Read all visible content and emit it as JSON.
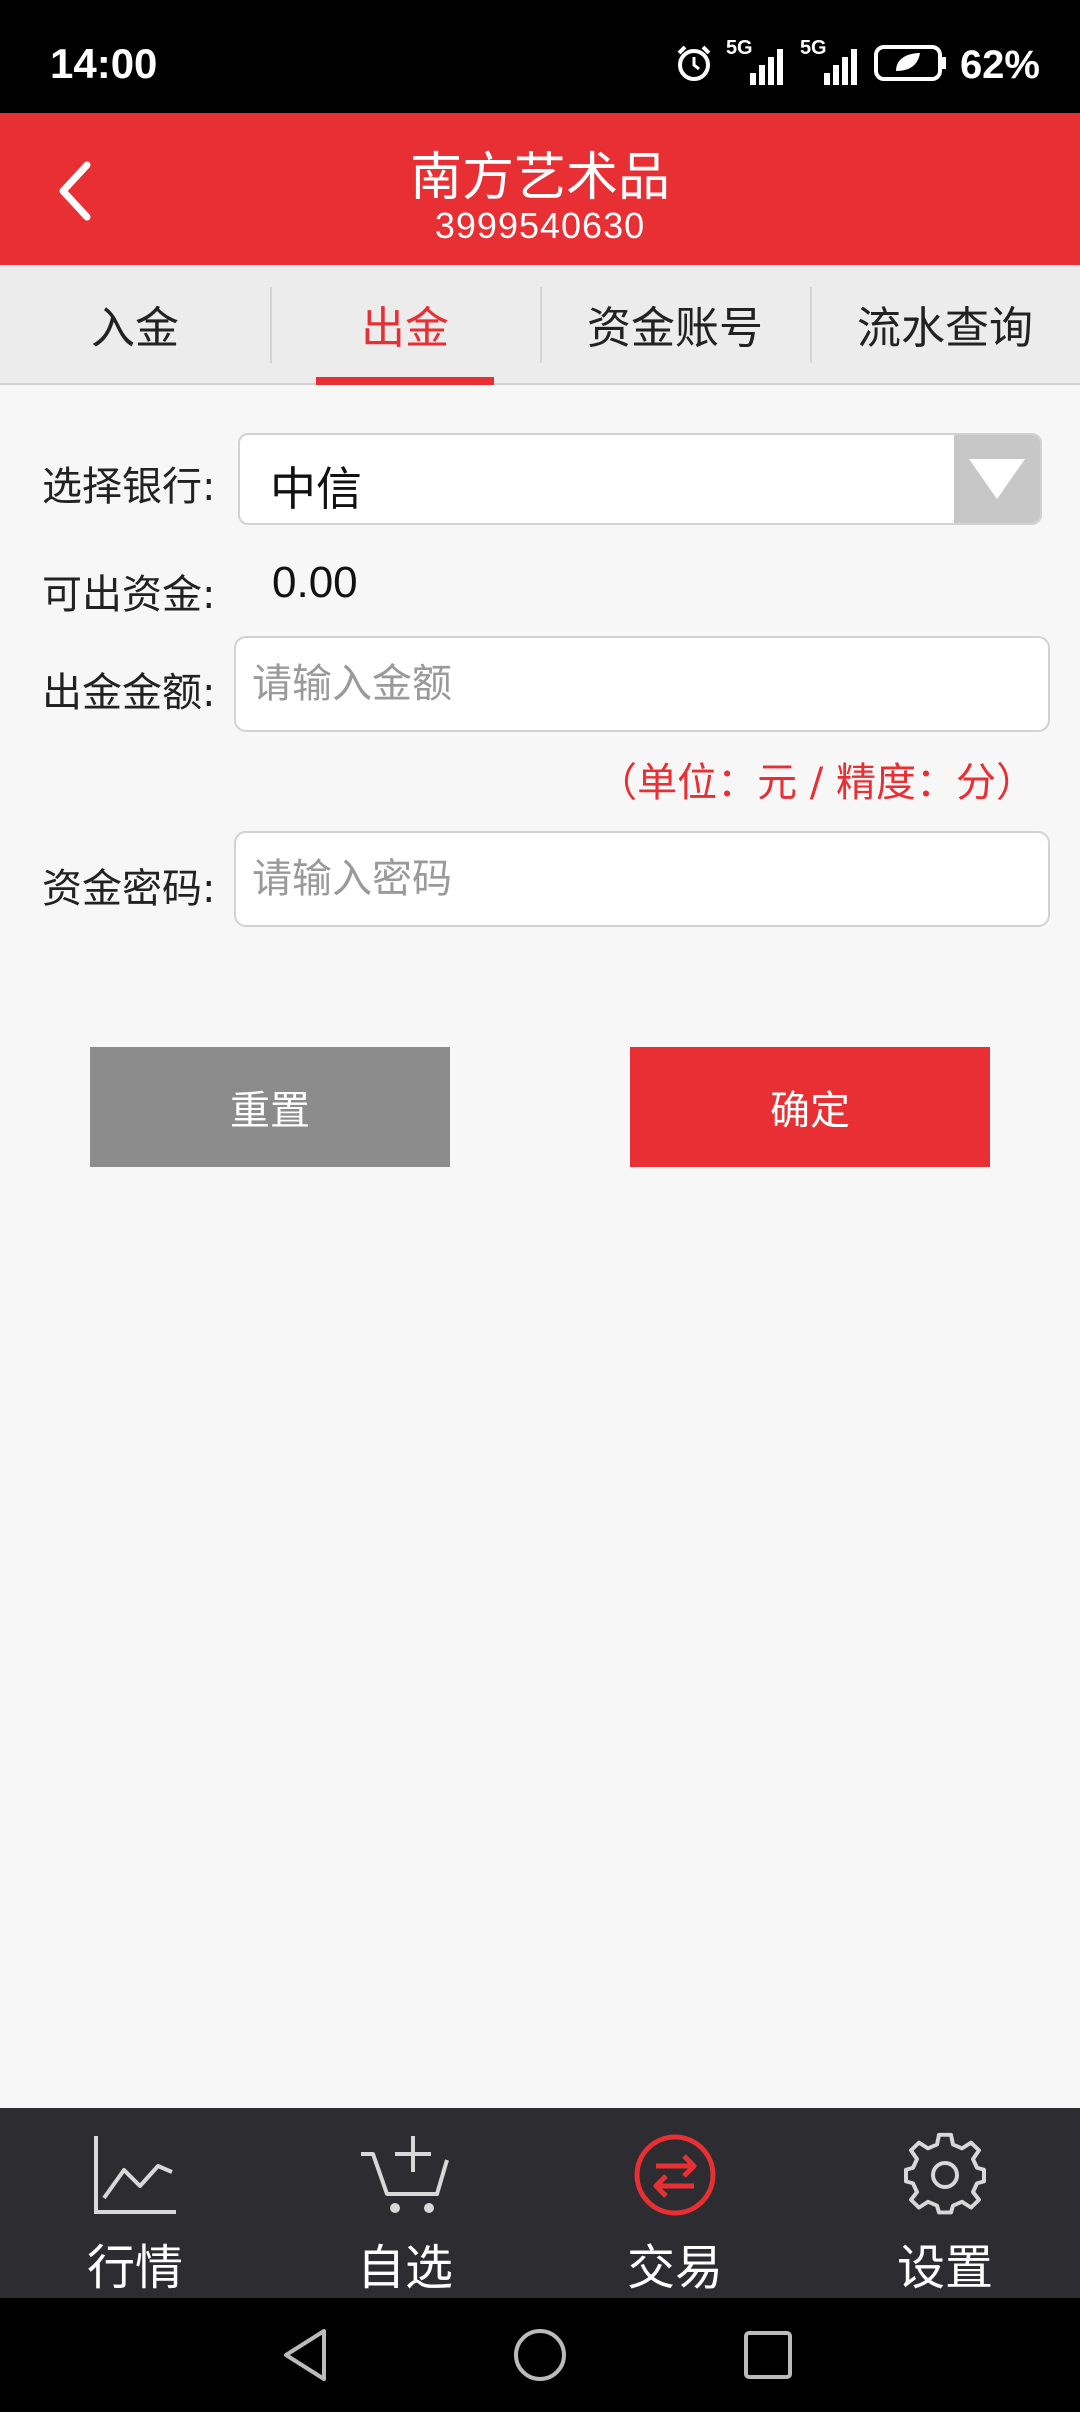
{
  "status_bar": {
    "time": "14:00",
    "network_1": "5G",
    "network_2": "5G",
    "battery": "62%",
    "icons": [
      "alarm-icon",
      "signal-icon",
      "battery-icon"
    ]
  },
  "header": {
    "title": "南方艺术品",
    "subtitle": "3999540630",
    "color": "#e83034"
  },
  "tabs": [
    {
      "label": "入金",
      "active": false
    },
    {
      "label": "出金",
      "active": true
    },
    {
      "label": "资金账号",
      "active": false
    },
    {
      "label": "流水查询",
      "active": false
    }
  ],
  "form": {
    "bank_label": "选择银行:",
    "bank_value": "中信",
    "available_label": "可出资金:",
    "available_value": "0.00",
    "amount_label": "出金金额:",
    "amount_placeholder": "请输入金额",
    "unit_hint": "（单位：元 / 精度：分）",
    "password_label": "资金密码:",
    "password_placeholder": "请输入密码"
  },
  "buttons": {
    "reset": "重置",
    "confirm": "确定"
  },
  "bottom_nav": [
    {
      "label": "行情",
      "icon": "chart-line-icon"
    },
    {
      "label": "自选",
      "icon": "cart-add-icon"
    },
    {
      "label": "交易",
      "icon": "exchange-icon",
      "active": true
    },
    {
      "label": "设置",
      "icon": "gear-icon"
    }
  ],
  "colors": {
    "accent": "#e83034",
    "nav_bg": "#2d2c31",
    "reset_bg": "#8c8c8c"
  }
}
